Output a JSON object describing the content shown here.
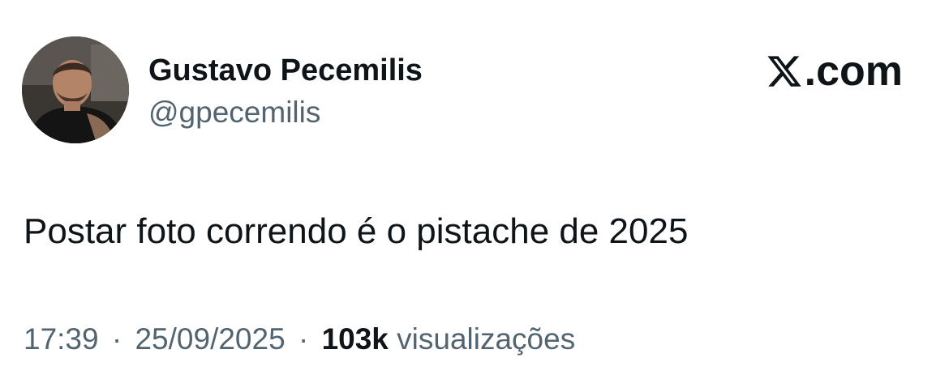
{
  "author": {
    "display_name": "Gustavo Pecemilis",
    "handle": "@gpecemilis",
    "avatar_icon": "profile-photo"
  },
  "brand": {
    "logo_icon": "x-logo-icon",
    "text": ".com"
  },
  "tweet": {
    "text": "Postar foto correndo é o pistache de 2025"
  },
  "meta": {
    "time": "17:39",
    "separator": "·",
    "date": "25/09/2025",
    "views_count": "103k",
    "views_label": "visualizações"
  },
  "colors": {
    "primary_text": "#0f1419",
    "secondary_text": "#536471",
    "background": "#ffffff"
  }
}
